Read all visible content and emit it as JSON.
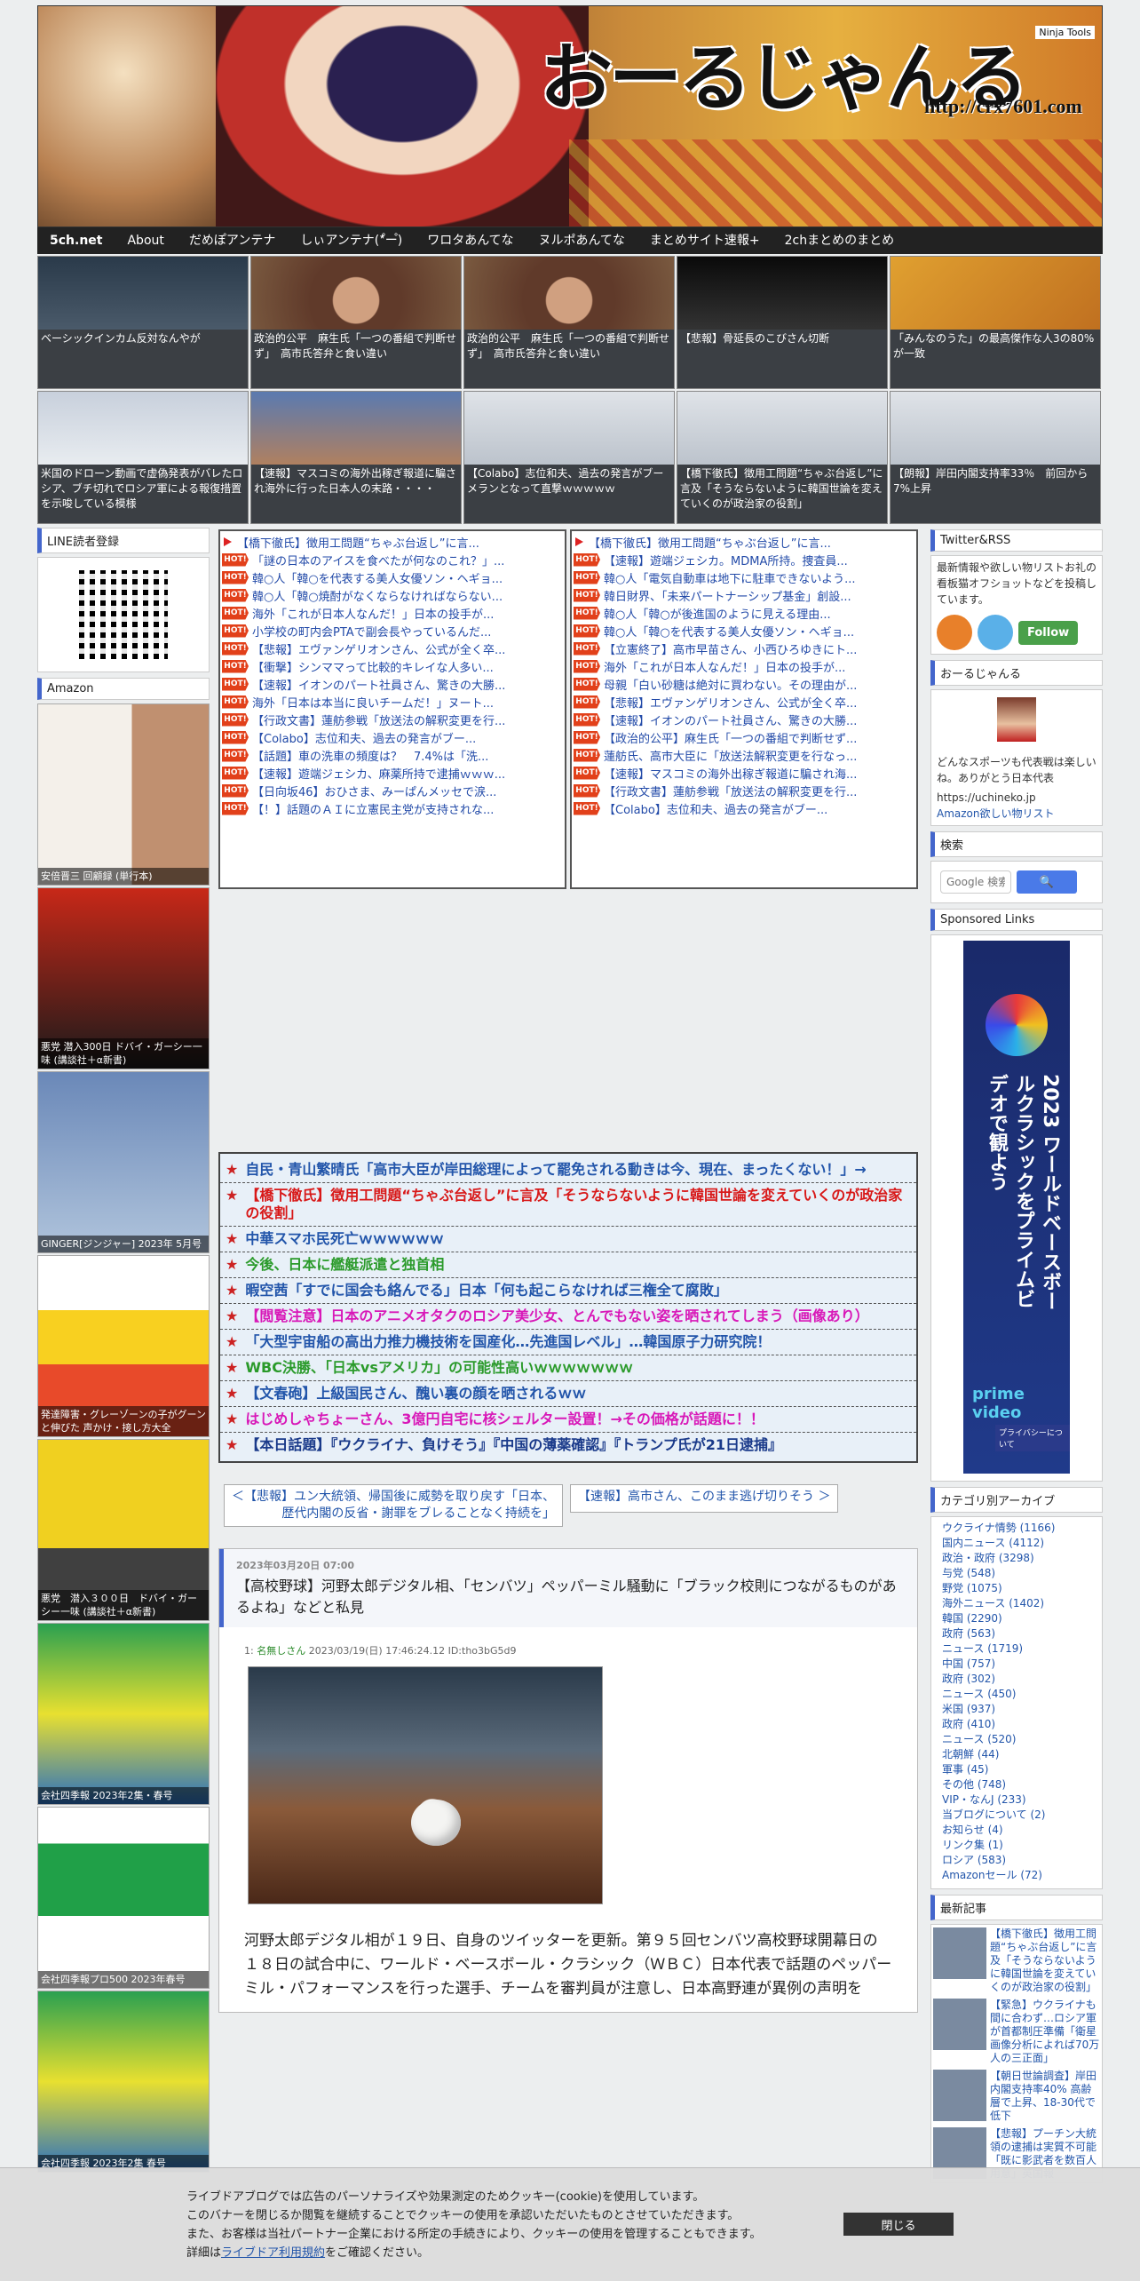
{
  "header": {
    "title": "おーるじゃんる",
    "url": "http://crx7601.com",
    "badge": "Ninja Tools"
  },
  "nav": [
    "5ch.net",
    "About",
    "だめぽアンテナ",
    "しぃアンテナ(*゚ー゚)",
    "ワロタあんてな",
    "ヌルポあんてな",
    "まとめサイト速報+",
    "2chまとめのまとめ"
  ],
  "thumbs": [
    "ベーシックインカム反対なんやが",
    "政治的公平　麻生氏「一つの番組で判断せず」　高市氏答弁と食い違い",
    "政治的公平　麻生氏「一つの番組で判断せず」　高市氏答弁と食い違い",
    "【悲報】骨延長のこびさん切断",
    "「みんなのうた」の最高傑作な人3の80%が一致",
    "米国のドローン動画で虚偽発表がバレたロシア、ブチ切れでロシア軍による報復措置を示唆している模様",
    "【速報】マスコミの海外出稼ぎ報道に騙され海外に行った日本人の末路・・・・",
    "【Colabo】志位和夫、過去の発言がブーメランとなって直撃ｗｗｗｗｗ",
    "【橋下徹氏】徴用工問題“ちゃぶ台返し”に言及「そうならないように韓国世論を変えていくのが政治家の役割」",
    "【朗報】岸田内閣支持率33％　前回から7%上昇"
  ],
  "left": {
    "line_title": "LINE読者登録",
    "amazon_title": "Amazon",
    "books": [
      "安倍晋三 回顧録 (単行本)",
      "悪党 潜入300日 ドバイ・ガーシー一味 (講談社＋α新書)",
      "GINGER[ジンジャー] 2023年 5月号",
      "発達障害・グレーゾーンの子がグーンと伸びた 声かけ・接し方大全",
      "悪党　潜入３００日　ドバイ・ガーシー一味 (講談社＋α新書)",
      "会社四季報 2023年2集・春号",
      "会社四季報プロ500 2023年春号",
      "会社四季報 2023年2集 春号"
    ]
  },
  "rss_left": [
    "【橋下徹氏】徴用工問題“ちゃぶ台返し”に言...",
    "「謎の日本のアイスを食べたが何なのこれ？」...",
    "韓○人「韓○を代表する美人女優ソン・ヘギョ...",
    "韓○人「韓○焼酎がなくならなければならない...",
    "海外「これが日本人なんだ！」日本の投手が...",
    "小学校の町内会PTAで副会長やっているんだ...",
    "【悲報】エヴァンゲリオンさん、公式が全く卒...",
    "【衝撃】シンママって比較的キレイな人多い...",
    "【速報】イオンのパート社員さん、驚きの大勝...",
    "海外「日本は本当に良いチームだ！」ヌート...",
    "【行政文書】蓮舫参戦「放送法の解釈変更を行...",
    "【Colabo】志位和夫、過去の発言がブー...",
    "【話題】車の洗車の頻度は？　7.4%は「洗...",
    "【速報】遊端ジェシカ、麻薬所持で逮捕ｗｗｗ...",
    "【日向坂46】おひさま、みーぱんメッセで涙...",
    "【！】話題のＡＩに立憲民主党が支持されな..."
  ],
  "rss_right": [
    "【橋下徹氏】徴用工問題“ちゃぶ台返し”に言...",
    "【速報】遊端ジェシカ。MDMA所持。捜査員...",
    "韓○人「電気自動車は地下に駐車できないよう...",
    "韓日財界、「未来パートナーシップ基金」創設...",
    "韓○人「韓○が後進国のように見える理由...",
    "韓○人「韓○を代表する美人女優ソン・ヘギョ...",
    "【立憲終了】高市早苗さん、小西ひろゆきにト...",
    "海外「これが日本人なんだ！」日本の投手が...",
    "母親「白い砂糖は絶対に買わない。その理由が...",
    "【悲報】エヴァンゲリオンさん、公式が全く卒...",
    "【速報】イオンのパート社員さん、驚きの大勝...",
    "【政治的公平】麻生氏「一つの番組で判断せず...",
    "蓮舫氏、高市大臣に「放送法解釈変更を行なっ...",
    "【速報】マスコミの海外出稼ぎ報道に騙され海...",
    "【行政文書】蓮舫参戦「放送法の解釈変更を行...",
    "【Colabo】志位和夫、過去の発言がブー..."
  ],
  "pickup": [
    {
      "text": "自民・青山繁晴氏「高市大臣が岸田総理によって罷免される動きは今、現在、まったくない！」→",
      "color": "c-blue"
    },
    {
      "text": "【橋下徹氏】徴用工問題“ちゃぶ台返し”に言及「そうならないように韓国世論を変えていくのが政治家の役割」",
      "color": "c-red"
    },
    {
      "text": "中華スマホ民死亡ｗｗｗｗｗｗ",
      "color": "c-blue"
    },
    {
      "text": "今後、日本に艦艇派遣と独首相",
      "color": "c-green"
    },
    {
      "text": "暇空茜「すでに国会も絡んでる」日本「何も起こらなければ三権全て腐敗」",
      "color": "c-blue"
    },
    {
      "text": "【閲覧注意】日本のアニメオタクのロシア美少女、とんでもない姿を晒されてしまう（画像あり）",
      "color": "c-magenta"
    },
    {
      "text": "「大型宇宙船の高出力推力機技術を国産化…先進国レベル」…韓国原子力研究院！",
      "color": "c-blue"
    },
    {
      "text": "WBC決勝、「日本vsアメリカ」の可能性高いｗｗｗｗｗｗｗ",
      "color": "c-green"
    },
    {
      "text": "【文春砲】上級国民さん、醜い裏の顔を晒されるｗｗ",
      "color": "c-blue"
    },
    {
      "text": "はじめしゃちょーさん、3億円自宅に核シェルター設置！→その価格が話題に！！",
      "color": "c-magenta"
    },
    {
      "text": "【本日話題】『ウクライナ、負けそう』『中国の薄薬確認』『トランプ氏が21日逮捕』",
      "color": "c-navy"
    }
  ],
  "prev_link": "＜【悲報】ユン大統領、帰国後に威勢を取り戻す「日本、歴代内閣の反省・謝罪をブレることなく持続を」",
  "next_link": "【速報】高市さん、このまま逃げ切りそう ＞",
  "article": {
    "date": "2023年03月20日 07:00",
    "title": "【高校野球】河野太郎デジタル相、「センバツ」ペッパーミル騒動に「ブラック校則につながるものがあるよね」などと私見",
    "res_num": "1:",
    "res_name": "名無しさん",
    "res_meta": "2023/03/19(日) 17:46:24.12 ID:tho3bG5d9",
    "body": "河野太郎デジタル相が１９日、自身のツイッターを更新。第９５回センバツ高校野球開幕日の１８日の試合中に、ワールド・ベースボール・クラシック（ＷＢＣ）日本代表で話題のペッパーミル・パフォーマンスを行った選手、チームを審判員が注意し、日本高野連が異例の声明を"
  },
  "right": {
    "twitter_title": "Twitter&RSS",
    "twitter_text": "最新情報や欲しい物リストお礼の看板猫オフショットなどを投稿しています。",
    "follow": "Follow",
    "profile_title": "おーるじゃんる",
    "profile_text": "どんなスポーツも代表戦は楽しいね。ありがとう日本代表",
    "profile_link1": "https://uchineko.jp",
    "profile_link2": "Amazon欲しい物リスト",
    "search_title": "検索",
    "search_placeholder": "Google 検索",
    "sponsored_title": "Sponsored Links",
    "ad_text": "2023 ワールドベースボールクラシックをプライムビデオで観よう",
    "ad_brand": "prime video",
    "ad_privacy": "プライバシーについて",
    "cat_title": "カテゴリ別アーカイブ",
    "cats": [
      "ウクライナ情勢 (1166)",
      "国内ニュース (4112)",
      "政治・政府 (3298)",
      "与党 (548)",
      "野党 (1075)",
      "海外ニュース (1402)",
      "韓国 (2290)",
      "政府 (563)",
      "ニュース (1719)",
      "中国 (757)",
      "政府 (302)",
      "ニュース (450)",
      "米国 (937)",
      "政府 (410)",
      "ニュース (520)",
      "北朝鮮 (44)",
      "軍事 (45)",
      "その他 (748)",
      "VIP・なんJ (233)",
      "当ブログについて (2)",
      "お知らせ (4)",
      "リンク集 (1)",
      "ロシア (583)",
      "Amazonセール (72)"
    ],
    "recent_title": "最新記事",
    "recent": [
      "【橋下徹氏】徴用工問題“ちゃぶ台返し”に言及「そうならないように韓国世論を変えていくのが政治家の役割」",
      "【緊急】ウクライナも間に合わず…ロシア軍が首都制圧準備「衛星画像分析によれば70万人の三正面」",
      "【朝日世論調査】岸田内閣支持率40% 高齢層で上昇、18-30代で低下",
      "【悲報】プーチン大統領の逮捕は実質不可能「既に影武者を数百人用意」英国報"
    ]
  },
  "cookie": {
    "lines": [
      "ライブドアブログでは広告のパーソナライズや効果測定のためクッキー(cookie)を使用しています。",
      "このバナーを閉じるか閲覧を継続することでクッキーの使用を承認いただいたものとさせていただきます。",
      "また、お客様は当社パートナー企業における所定の手続きにより、クッキーの使用を管理することもできます。"
    ],
    "detail_prefix": "詳細は",
    "detail_link": "ライブドア利用規約",
    "detail_suffix": "をご確認ください。",
    "close": "閉じる"
  }
}
